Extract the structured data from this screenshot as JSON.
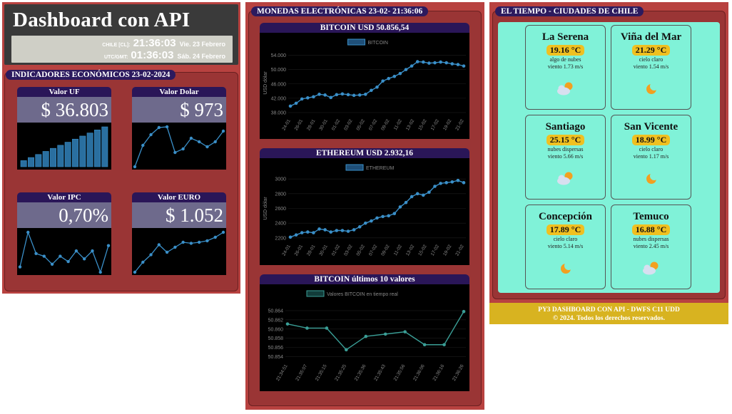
{
  "header": {
    "title": "Dashboard con API",
    "chile_label": "CHILE [CL]:",
    "chile_time": "21:36:03",
    "chile_date": "Vie. 23 Febrero",
    "utc_label": "UTC/GMT:",
    "utc_time": "01:36:03",
    "utc_date": "Sáb. 24 Febrero"
  },
  "indicators": {
    "title": "INDICADORES ECONÓMICOS 23-02-2024",
    "cards": [
      {
        "title": "Valor UF",
        "value": "$ 36.803",
        "chart_type": "bar",
        "values": [
          2,
          3,
          4,
          5,
          6,
          7,
          8,
          9,
          10,
          11,
          12,
          13
        ]
      },
      {
        "title": "Valor Dolar",
        "value": "$ 973",
        "chart_type": "line",
        "values": [
          3,
          6,
          7.5,
          8.5,
          8.6,
          5,
          5.5,
          7,
          6.5,
          5.8,
          6.5,
          8
        ]
      },
      {
        "title": "Valor IPC",
        "value": "0,70%",
        "chart_type": "line",
        "values": [
          2,
          8.5,
          4.5,
          4,
          2.5,
          4,
          3,
          5,
          3.5,
          5,
          1,
          6
        ]
      },
      {
        "title": "Valor EURO",
        "value": "$ 1.052",
        "chart_type": "line",
        "values": [
          2,
          4,
          5.5,
          7.5,
          6,
          7,
          8,
          7.8,
          8,
          8.3,
          9,
          10
        ]
      }
    ]
  },
  "crypto": {
    "title": "MONEDAS ELECTRÓNICAS   23-02- 21:36:06",
    "charts": [
      {
        "title": "BITCOIN USD 50.856,54",
        "chart_data": {
          "type": "line",
          "legend": "BITCOIN",
          "ylabel": "USD dólar",
          "ylim": [
            37000,
            55500
          ],
          "yticks": [
            "54.000",
            "50.000",
            "46.000",
            "42.000",
            "38.000"
          ],
          "ytick_values": [
            54000,
            50000,
            46000,
            42000,
            38000
          ],
          "xticks": [
            "24-01",
            "26-01",
            "28-01",
            "30-01",
            "01-02",
            "03-02",
            "05-02",
            "07-02",
            "09-02",
            "11-02",
            "13-02",
            "15-02",
            "17-02",
            "19-02",
            "21-02"
          ],
          "values": [
            39800,
            40600,
            41800,
            42100,
            42400,
            43100,
            42900,
            42200,
            43000,
            43200,
            43000,
            42800,
            42900,
            43100,
            44200,
            45100,
            46800,
            47500,
            48100,
            48900,
            50000,
            51000,
            52200,
            52100,
            51800,
            51900,
            52100,
            51900,
            51600,
            51400,
            51000
          ]
        }
      },
      {
        "title": "ETHEREUM USD 2.932,16",
        "chart_data": {
          "type": "line",
          "legend": "ETHEREUM",
          "ylabel": "USD dólar",
          "ylim": [
            2150,
            3050
          ],
          "yticks": [
            "3000",
            "2800",
            "2600",
            "2400",
            "2200"
          ],
          "ytick_values": [
            3000,
            2800,
            2600,
            2400,
            2200
          ],
          "xticks": [
            "24-01",
            "26-01",
            "28-01",
            "30-01",
            "01-02",
            "03-02",
            "05-02",
            "07-02",
            "09-02",
            "11-02",
            "13-02",
            "15-02",
            "17-02",
            "19-02",
            "21-02"
          ],
          "values": [
            2210,
            2240,
            2270,
            2280,
            2270,
            2320,
            2310,
            2280,
            2300,
            2300,
            2290,
            2310,
            2350,
            2400,
            2430,
            2470,
            2490,
            2500,
            2530,
            2620,
            2680,
            2760,
            2800,
            2780,
            2820,
            2900,
            2940,
            2950,
            2960,
            2980,
            2950
          ]
        }
      },
      {
        "title": "BITCOIN últimos 10 valores",
        "chart_data": {
          "type": "line",
          "legend": "Valores BITCOIN en tiempo real",
          "ylim": [
            50.853,
            50.866
          ],
          "yticks": [
            "50.864",
            "50.862",
            "50.860",
            "50.858",
            "50.856",
            "50.854"
          ],
          "ytick_values": [
            50.864,
            50.862,
            50.86,
            50.858,
            50.856,
            50.854
          ],
          "xticks": [
            "21:34:51",
            "21:35:07",
            "21:35:15",
            "21:35:25",
            "21:35:36",
            "21:35:43",
            "21:35:56",
            "21:36:06",
            "21:36:16",
            "21:36:26"
          ],
          "values": [
            50.8611,
            50.8602,
            50.8602,
            50.8555,
            50.8584,
            50.8589,
            50.8594,
            50.8566,
            50.8566,
            50.8638
          ]
        }
      }
    ]
  },
  "weather": {
    "title": "EL TIEMPO - CIUDADES DE CHILE",
    "cities": [
      {
        "name": "La Serena",
        "temp": "19.16 °C",
        "desc": "algo de nubes",
        "wind": "viento 1.73 m/s",
        "icon": "cloud-sun"
      },
      {
        "name": "Viña del Mar",
        "temp": "21.29 °C",
        "desc": "cielo claro",
        "wind": "viento 1.54 m/s",
        "icon": "moon"
      },
      {
        "name": "Santiago",
        "temp": "25.15 °C",
        "desc": "nubes dispersas",
        "wind": "viento 5.66 m/s",
        "icon": "cloud-sun"
      },
      {
        "name": "San Vicente",
        "temp": "18.99 °C",
        "desc": "cielo claro",
        "wind": "viento 1.17 m/s",
        "icon": "moon"
      },
      {
        "name": "Concepción",
        "temp": "17.89 °C",
        "desc": "cielo claro",
        "wind": "viento 5.14 m/s",
        "icon": "moon"
      },
      {
        "name": "Temuco",
        "temp": "16.88 °C",
        "desc": "nubes dispersas",
        "wind": "viento 2.45 m/s",
        "icon": "cloud-sun"
      }
    ]
  },
  "footer": {
    "line1": "PY3 DASHBOARD CON API - DWFS C11 UDD",
    "line2": "© 2024. Todos los derechos reservados."
  },
  "colors": {
    "panel": "#b84240",
    "title_bar": "#2a1658",
    "line": "#3a8fc8",
    "weather_bg": "#80f2d8",
    "temp_badge": "#f0c020",
    "footer": "#d8b320"
  }
}
